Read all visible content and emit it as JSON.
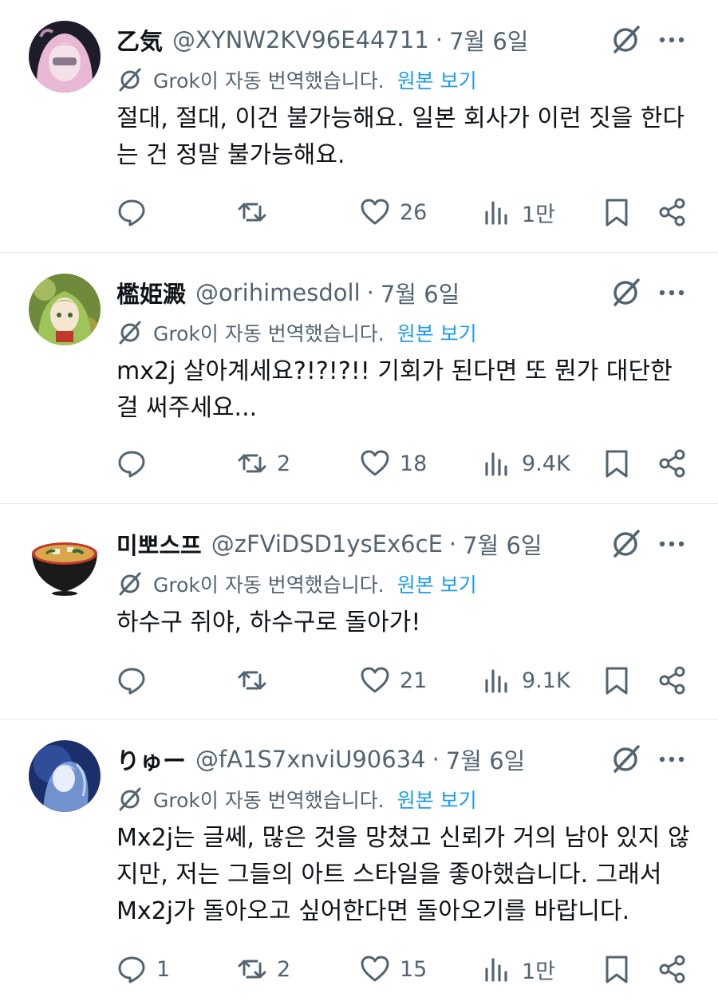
{
  "translation": {
    "notice": "Grok이 자동 번역했습니다.",
    "link": "원본 보기"
  },
  "tweets": [
    {
      "name": "乙気",
      "handle": "@XYNW2KV96E44711",
      "sep": "·",
      "date": "7월 6일",
      "text": "절대, 절대, 이건 불가능해요. 일본 회사가 이런 짓을 한다\n는 건 정말 불가능해요.",
      "replies": "",
      "retweets": "",
      "likes": "26",
      "views": "1만",
      "avatar_colors": {
        "bg": "#1c1c2a",
        "hair": "#e9b8d4",
        "face": "#f4e1e8"
      }
    },
    {
      "name": "檻姫澱",
      "handle": "@orihimesdoll",
      "sep": "·",
      "date": "7월 6일",
      "text": "mx2j 살아계세요?!?!?!! 기회가 된다면 또 뭔가 대단한\n걸 써주세요...",
      "replies": "",
      "retweets": "2",
      "likes": "18",
      "views": "9.4K",
      "avatar_colors": {
        "bg": "#6f8a3a",
        "hair": "#9fc45a",
        "face": "#f5e6d3"
      }
    },
    {
      "name": "미뽀스프",
      "handle": "@zFViDSD1ysEx6cE",
      "sep": "·",
      "date": "7월 6일",
      "text": "하수구 쥐야, 하수구로 돌아가!",
      "replies": "",
      "retweets": "",
      "likes": "21",
      "views": "9.1K",
      "avatar_colors": {
        "bg": "#ffffff",
        "bowl": "#1a1a1a",
        "soup": "#d9a64a",
        "rim": "#c0392b"
      }
    },
    {
      "name": "りゅー",
      "handle": "@fA1S7xnviU90634",
      "sep": "·",
      "date": "7월 6일",
      "text": "Mx2j는 글쎄, 많은 것을 망쳤고 신뢰가 거의 남아 있지 않\n지만, 저는 그들의 아트 스타일을 좋아했습니다. 그래서\nMx2j가 돌아오고 싶어한다면 돌아오기를 바랍니다.",
      "replies": "1",
      "retweets": "2",
      "likes": "15",
      "views": "1만",
      "avatar_colors": {
        "bg": "#1b2f6b",
        "glow": "#8fb4f0",
        "face": "#e8eefc"
      }
    }
  ],
  "colors": {
    "text": "#0f1419",
    "secondary": "#536471",
    "link": "#1d9bf0",
    "divider": "#e6e9ec"
  },
  "icons": [
    "grok-icon",
    "more-icon",
    "translate-icon",
    "reply-icon",
    "retweet-icon",
    "like-icon",
    "views-icon",
    "bookmark-icon",
    "share-icon"
  ]
}
